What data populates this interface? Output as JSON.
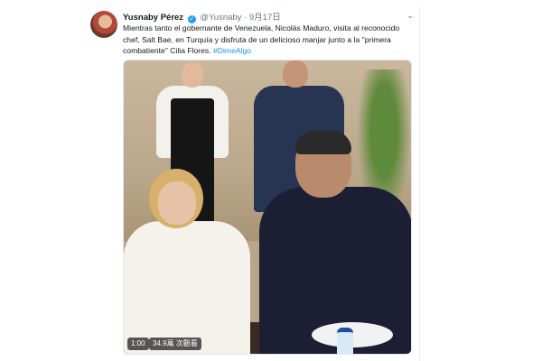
{
  "tweet": {
    "author_name": "Yusnaby Pérez",
    "handle": "@Yusnaby",
    "separator": "·",
    "date": "9月17日",
    "verified_glyph": "✓",
    "menu_glyph": "⌄",
    "text": "Mientras tanto el gobernante de Venezuela, Nicolás Maduro, visita al reconocido chef, Salt Bae, en Turquía y disfruta de un delicioso manjar junto a la \"primera combatiente\" Cilia Flores. ",
    "hashtag": "#DimeAlgo",
    "video": {
      "duration": "1:00",
      "views": "34.9萬 次觀看"
    }
  },
  "icons": {
    "verified": "verified-badge-icon",
    "menu": "chevron-down-icon"
  },
  "colors": {
    "link": "#1b95e0",
    "verified": "#1da1f2",
    "muted": "#657786"
  }
}
